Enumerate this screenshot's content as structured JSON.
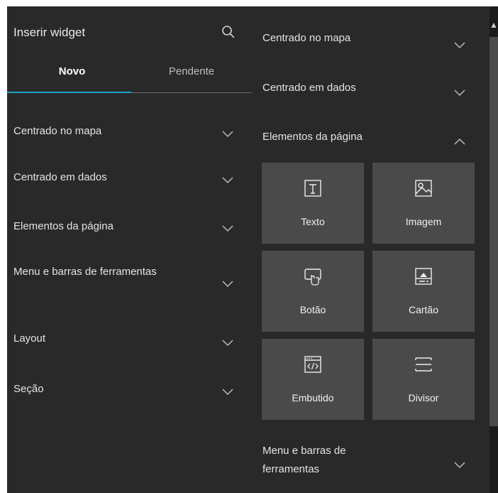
{
  "left_panel": {
    "title": "Inserir widget",
    "search_icon": "search-icon",
    "tabs": [
      {
        "label": "Novo",
        "active": true
      },
      {
        "label": "Pendente",
        "active": false
      }
    ],
    "accent_color": "#1fa3c6",
    "categories": [
      {
        "label": "Centrado no mapa"
      },
      {
        "label": "Centrado em dados"
      },
      {
        "label": "Elementos da página"
      },
      {
        "label": "Menu e barras de ferramentas"
      },
      {
        "label": "Layout"
      },
      {
        "label": "Seção"
      }
    ]
  },
  "right_panel": {
    "categories": [
      {
        "label": "Centrado no mapa",
        "expanded": false
      },
      {
        "label": "Centrado em dados",
        "expanded": false
      },
      {
        "label": "Elementos da página",
        "expanded": true
      },
      {
        "label": "Menu e barras de ferramentas",
        "expanded": false
      }
    ],
    "widgets": [
      {
        "label": "Texto",
        "icon": "text-icon"
      },
      {
        "label": "Imagem",
        "icon": "image-icon"
      },
      {
        "label": "Botão",
        "icon": "button-icon"
      },
      {
        "label": "Cartão",
        "icon": "card-icon"
      },
      {
        "label": "Embutido",
        "icon": "embed-icon"
      },
      {
        "label": "Divisor",
        "icon": "divider-icon"
      }
    ]
  },
  "colors": {
    "panel_bg": "#292929",
    "tile_bg": "#4a4a4a",
    "text": "#e4e4e4"
  }
}
